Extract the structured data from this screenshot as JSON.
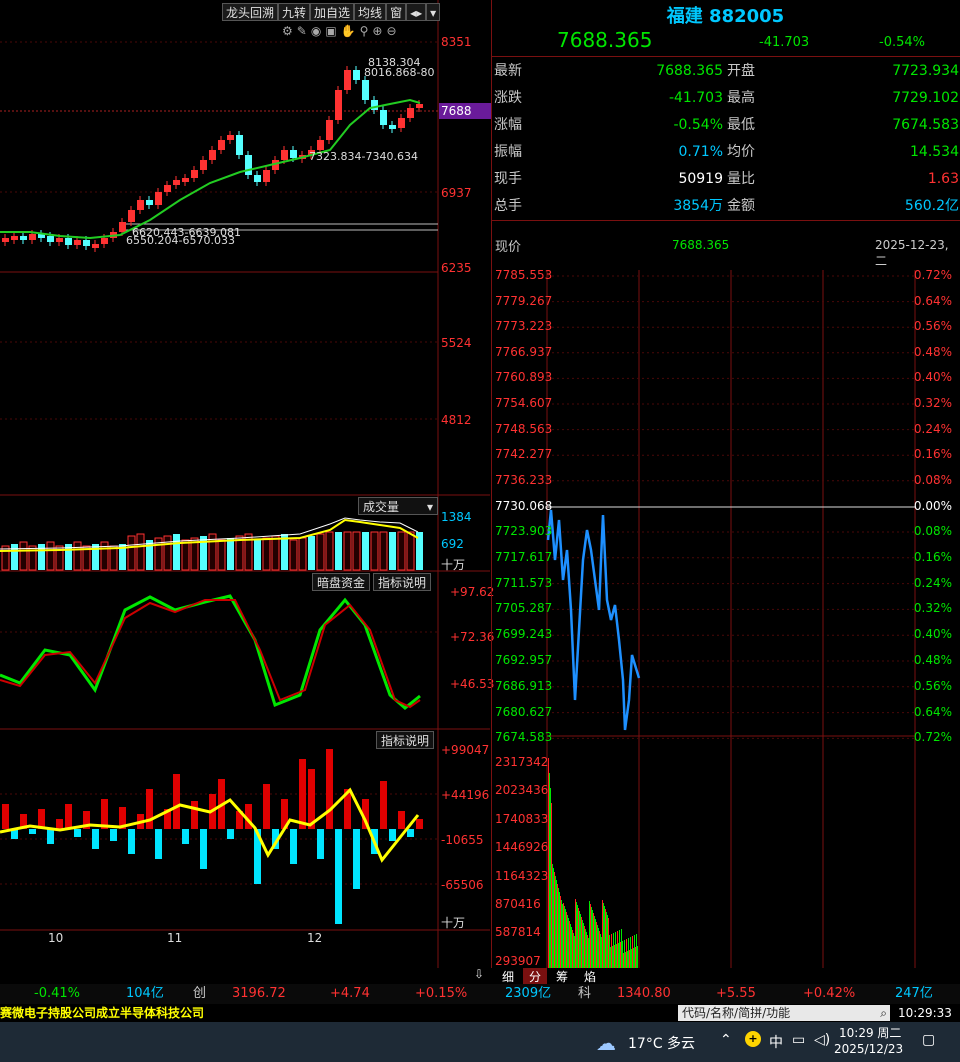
{
  "toolbar": {
    "buttons": [
      "龙头回溯",
      "九转",
      "加自选",
      "均线",
      "窗"
    ]
  },
  "kline": {
    "price_axis": [
      "8351",
      "6937",
      "6235",
      "5524",
      "4812"
    ],
    "current_tag": "7688",
    "annotations": {
      "high": "8138.304",
      "high2": "8016.868-80",
      "mid": "7323.834-7340.634",
      "low1": "6620.443-6639.081",
      "low2": "6550.204-6570.033"
    },
    "volume_title": "成交量",
    "volume_axis": [
      "1384",
      "692",
      "十万"
    ],
    "indicator1": {
      "title": "暗盘资金",
      "explain": "指标说明",
      "axis": [
        "+97.62",
        "+72.36",
        "+46.53"
      ]
    },
    "indicator2": {
      "explain": "指标说明",
      "axis": [
        "+99047",
        "+44196",
        "-10655",
        "-65506",
        "十万"
      ]
    },
    "months": [
      "10",
      "11",
      "12"
    ]
  },
  "quote": {
    "name": "福建 882005",
    "price": "7688.365",
    "change": "-41.703",
    "pct": "-0.54%",
    "rows": [
      {
        "k1": "最新",
        "v1": "7688.365",
        "c1": "#00e600",
        "k2": "开盘",
        "v2": "7723.934",
        "c2": "#00e600"
      },
      {
        "k1": "涨跌",
        "v1": "-41.703",
        "c1": "#00e600",
        "k2": "最高",
        "v2": "7729.102",
        "c2": "#00e600"
      },
      {
        "k1": "涨幅",
        "v1": "-0.54%",
        "c1": "#00e600",
        "k2": "最低",
        "v2": "7674.583",
        "c2": "#00e600"
      },
      {
        "k1": "振幅",
        "v1": "0.71%",
        "c1": "#00c8ff",
        "k2": "均价",
        "v2": "14.534",
        "c2": "#00e600"
      },
      {
        "k1": "现手",
        "v1": "50919",
        "c1": "#ffffff",
        "k2": "量比",
        "v2": "1.63",
        "c2": "#ff3232"
      },
      {
        "k1": "总手",
        "v1": "3854万",
        "c1": "#00c8ff",
        "k2": "金额",
        "v2": "560.2亿",
        "c2": "#00c8ff"
      }
    ],
    "now_label": "现价",
    "now_value": "7688.365",
    "date": "2025-12-23,二",
    "price_axis_up": [
      "7785.553",
      "7779.267",
      "7773.223",
      "7766.937",
      "7760.893",
      "7754.607",
      "7748.563",
      "7742.277",
      "7736.233"
    ],
    "price_axis_mid": "7730.068",
    "price_axis_down": [
      "7723.903",
      "7717.617",
      "7711.573",
      "7705.287",
      "7699.243",
      "7692.957",
      "7686.913",
      "7680.627",
      "7674.583"
    ],
    "pct_axis_up": [
      "0.72%",
      "0.64%",
      "0.56%",
      "0.48%",
      "0.40%",
      "0.32%",
      "0.24%",
      "0.16%",
      "0.08%"
    ],
    "pct_axis_mid": "0.00%",
    "pct_axis_down": [
      "0.08%",
      "0.16%",
      "0.24%",
      "0.32%",
      "0.40%",
      "0.48%",
      "0.56%",
      "0.64%",
      "0.72%"
    ],
    "vol_axis": [
      "2317342",
      "2023436",
      "1740833",
      "1446926",
      "1164323",
      "870416",
      "587814",
      "293907"
    ],
    "tabs": [
      "细",
      "分",
      "筹",
      "焰"
    ]
  },
  "status": {
    "pct1": "-0.41%",
    "amt1": "104亿",
    "chuang_label": "创",
    "chuang_val": "3196.72",
    "chuang_chg": "+4.74",
    "chuang_pct": "+0.15%",
    "amt2": "2309亿",
    "ke_label": "科",
    "ke_val": "1340.80",
    "ke_chg": "+5.55",
    "ke_pct": "+0.42%",
    "amt3": "247亿"
  },
  "ticker": {
    "text": "赛微电子持股公司成立半导体科技公司",
    "search_placeholder": "代码/名称/简拼/功能",
    "time": "10:29:33"
  },
  "taskbar": {
    "weather": "17°C 多云",
    "clock_time": "10:29 周二",
    "clock_date": "2025/12/23",
    "ime": "中"
  }
}
